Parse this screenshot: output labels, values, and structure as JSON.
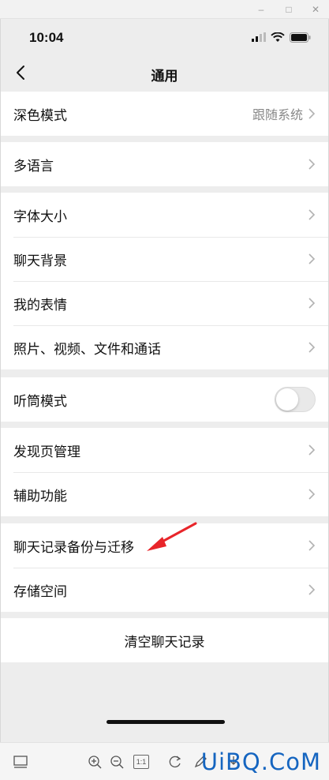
{
  "status_bar": {
    "time": "10:04"
  },
  "nav": {
    "title": "通用"
  },
  "groups": {
    "dark_mode": {
      "label": "深色模式",
      "value": "跟随系统"
    },
    "language": {
      "label": "多语言"
    },
    "font_size": {
      "label": "字体大小"
    },
    "chat_background": {
      "label": "聊天背景"
    },
    "my_stickers": {
      "label": "我的表情"
    },
    "media": {
      "label": "照片、视频、文件和通话"
    },
    "earpiece": {
      "label": "听筒模式",
      "enabled": false
    },
    "discover": {
      "label": "发现页管理"
    },
    "accessibility": {
      "label": "辅助功能"
    },
    "backup": {
      "label": "聊天记录备份与迁移"
    },
    "storage": {
      "label": "存储空间"
    },
    "clear_history": {
      "label": "清空聊天记录"
    }
  },
  "accent": {
    "arrow_color": "#e8252a",
    "toggle_off": "#e9e9e9"
  },
  "toolbar": {
    "actual_size_label": "1:1"
  },
  "watermark": {
    "text": "UiBQ.CoM"
  }
}
